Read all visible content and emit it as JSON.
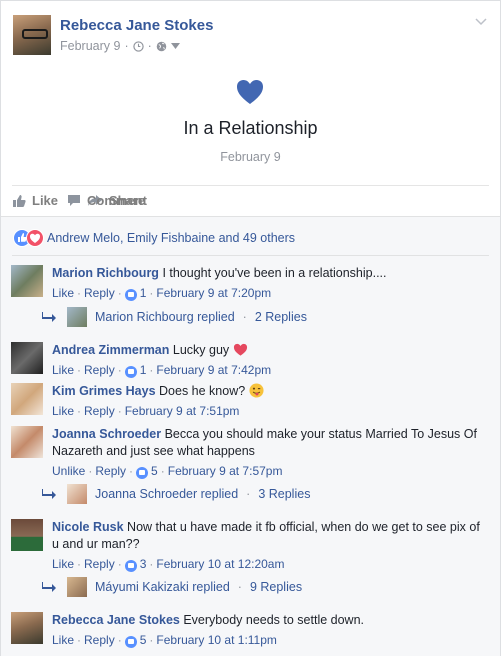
{
  "post": {
    "author": "Rebecca Jane Stokes",
    "date": "February 9",
    "meta_sep": "·",
    "life_event": "In a Relationship",
    "life_event_date": "February 9"
  },
  "actions": {
    "like": "Like",
    "comment": "Comment",
    "share": "Share"
  },
  "reactions": {
    "text": "Andrew Melo, Emily Fishbaine and 49 others"
  },
  "comments": [
    {
      "name": "Marion Richbourg",
      "text": "I thought you've been in a relationship....",
      "like_label": "Like",
      "reply_label": "Reply",
      "like_count": "1",
      "date": "February 9 at 7:20pm",
      "replies": {
        "who": "Marion Richbourg replied",
        "count": "2 Replies"
      }
    },
    {
      "name": "Andrea Zimmerman",
      "text": "Lucky guy",
      "like_label": "Like",
      "reply_label": "Reply",
      "like_count": "1",
      "date": "February 9 at 7:42pm"
    },
    {
      "name": "Kim Grimes Hays",
      "text": "Does he know?",
      "like_label": "Like",
      "reply_label": "Reply",
      "date": "February 9 at 7:51pm"
    },
    {
      "name": "Joanna Schroeder",
      "text": "Becca you should make your status Married To Jesus Of Nazareth and just see what happens",
      "like_label": "Unlike",
      "reply_label": "Reply",
      "like_count": "5",
      "date": "February 9 at 7:57pm",
      "replies": {
        "who": "Joanna Schroeder replied",
        "count": "3 Replies"
      }
    },
    {
      "name": "Nicole Rusk",
      "text": "Now that u have made it fb official, when do we get to see pix of u and ur man??",
      "like_label": "Like",
      "reply_label": "Reply",
      "like_count": "3",
      "date": "February 10 at 12:20am",
      "replies": {
        "who": "Máyumi Kakizaki replied",
        "count": "9 Replies"
      }
    },
    {
      "name": "Rebecca Jane Stokes",
      "text": "Everybody needs to settle down.",
      "like_label": "Like",
      "reply_label": "Reply",
      "like_count": "5",
      "date": "February 10 at 1:11pm"
    }
  ],
  "sep": "·",
  "colors": {
    "link": "#365899",
    "heart": "#4267b2",
    "like_badge": "#5890ff",
    "love_badge": "#f25268",
    "muted": "#90949c"
  },
  "icons": {
    "post_menu": "chevron-down-icon",
    "privacy": "globe-icon",
    "clock": "clock-icon",
    "like": "thumbs-up-icon",
    "comment": "speech-bubble-icon",
    "share": "share-arrow-icon",
    "reply": "reply-arrow-icon"
  }
}
